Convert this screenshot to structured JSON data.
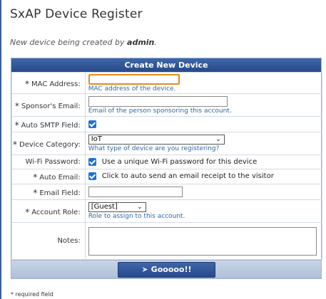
{
  "page": {
    "title": "SxAP Device Register",
    "subtitle_prefix": "New device being created by",
    "subtitle_user": "admin",
    "subtitle_suffix": "."
  },
  "form": {
    "header": "Create New Device",
    "required_marker": "*",
    "mac": {
      "label": "MAC Address:",
      "value": "",
      "hint": "MAC address of the device."
    },
    "sponsor_email": {
      "label": "Sponsor's Email:",
      "value": "",
      "hint": "Email of the person sponsoring this account."
    },
    "auto_smtp": {
      "label": "Auto SMTP Field:",
      "checked": true
    },
    "device_category": {
      "label": "Device Category:",
      "selected": "IoT",
      "hint": "What type of device are you registering?"
    },
    "wifi_password": {
      "label": "Wi-Fi Password:",
      "checked": true,
      "text": "Use a unique Wi-Fi password for this device"
    },
    "auto_email": {
      "label": "Auto Email:",
      "checked": true,
      "text": "Click to auto send an email receipt to the visitor"
    },
    "email_field": {
      "label": "Email Field:",
      "value": ""
    },
    "account_role": {
      "label": "Account Role:",
      "selected": "[Guest]",
      "hint": "Role to assign to this account."
    },
    "notes": {
      "label": "Notes:",
      "value": ""
    },
    "submit_label": "Gooooo!!"
  },
  "footnote": "required field",
  "colors": {
    "header_blue": "#2f5597",
    "hint_blue": "#2d6aa8",
    "focus_orange": "#e88a1a",
    "checkbox_blue": "#1a73d9"
  }
}
